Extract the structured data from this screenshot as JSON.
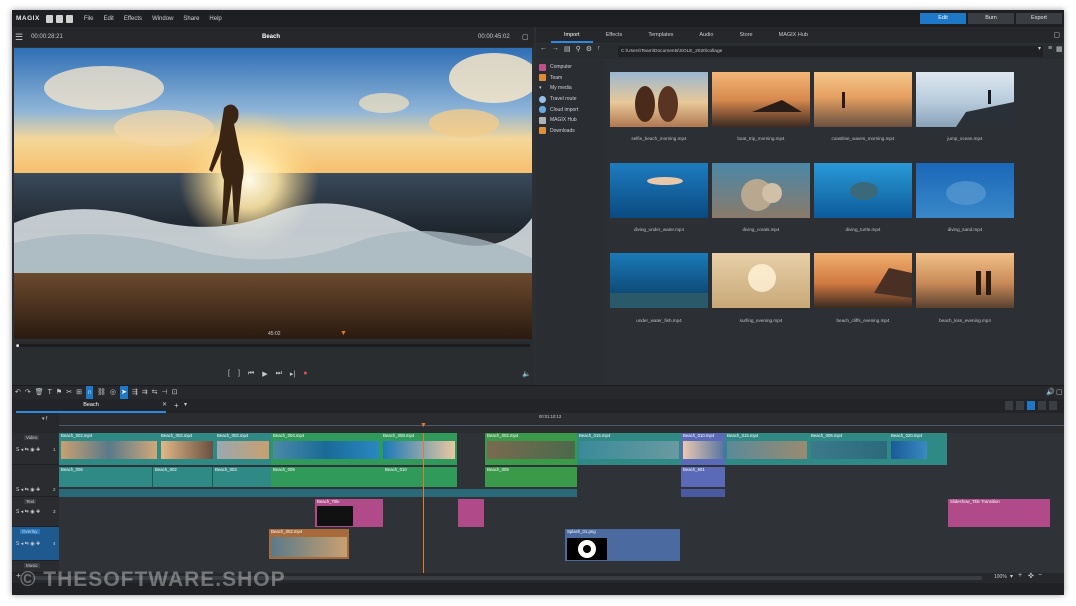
{
  "app": {
    "logo": "MAGIX"
  },
  "menu": [
    "File",
    "Edit",
    "Effects",
    "Window",
    "Share",
    "Help"
  ],
  "modes": [
    {
      "label": "Edit",
      "active": true
    },
    {
      "label": "Burn",
      "active": false
    },
    {
      "label": "Export",
      "active": false
    }
  ],
  "preview": {
    "timecode": "00:00:28:21",
    "title": "Beach",
    "duration": "00:00:45:02",
    "position": "45:02"
  },
  "media_pool": {
    "tabs": [
      {
        "label": "Import",
        "active": true
      },
      {
        "label": "Effects"
      },
      {
        "label": "Templates"
      },
      {
        "label": "Audio"
      },
      {
        "label": "Store"
      },
      {
        "label": "MAGIX Hub"
      }
    ],
    "path": "C:\\Users\\Team\\Documents\\SOLE_2020\\collage",
    "sidebar": [
      {
        "label": "Computer",
        "color": "#c0508a"
      },
      {
        "label": "Team",
        "color": "#e08a3c"
      },
      {
        "label": "My media",
        "color": "#9aa0a6"
      },
      {
        "label": "Travel route",
        "color": "#9ac0e8"
      },
      {
        "label": "Cloud import",
        "color": "#6aa8e0"
      },
      {
        "label": "MAGIX Hub",
        "color": "#b0b4b8"
      },
      {
        "label": "Downloads",
        "color": "#e0903a"
      }
    ],
    "files": [
      "selfie_beach_morning.mp4",
      "boat_trip_morning.mp4",
      "coastline_waves_morning.mp4",
      "jump_ocean.mp4",
      "diving_under_water.mp4",
      "diving_corals.mp4",
      "diving_turtle.mp4",
      "diving_sand.mp4",
      "under_water_fish.mp4",
      "surfing_evening.mp4",
      "beach_cliffs_evening.mp4",
      "beach_kiss_evening.mp4"
    ]
  },
  "timeline": {
    "tab": "Beach",
    "playhead": "00:01:10:13",
    "tracks": [
      {
        "label": "Video",
        "num": "1"
      },
      {
        "label": "",
        "num": "2"
      },
      {
        "label": "Text",
        "num": "3"
      },
      {
        "label": "Overlay",
        "num": "4"
      },
      {
        "label": "Music",
        "num": "5"
      }
    ],
    "clips": {
      "t1": [
        "Beach_002.mp4",
        "Beach_002.mp4",
        "Beach_002.mp4",
        "Beach_004.mp4",
        "Beach_008.mp4",
        "Beach_002.mp4",
        "Beach_015.mp4",
        "Beach_010.mp4",
        "Beach_015.mp4",
        "Beach_006.mp4",
        "Beach_020.mp4"
      ],
      "t2": [
        "Beach_006",
        "Beach_002",
        "Beach_003",
        "Beach_009",
        "Beach_010",
        "Beach_009",
        "Beach_601"
      ],
      "t3": [
        "Beach_Title",
        "Slideshow_Title Transition"
      ],
      "t4": [
        "Beach_002.mp4",
        "Splash_01.png"
      ]
    },
    "zoom": "100%"
  },
  "watermark": "© THESOFTWARE.SHOP"
}
